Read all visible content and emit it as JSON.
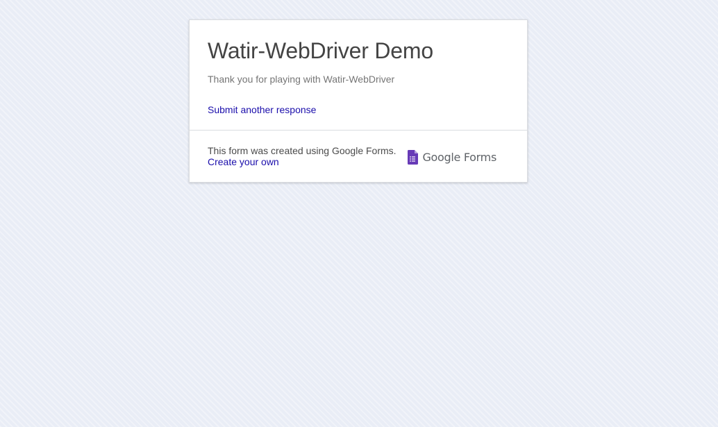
{
  "form": {
    "title": "Watir-WebDriver Demo",
    "confirmation": "Thank you for playing with Watir-WebDriver",
    "submit_another_label": "Submit another response"
  },
  "footer": {
    "created_text": "This form was created using Google Forms.",
    "create_own_label": "Create your own",
    "logo_text": "Google Forms",
    "logo_icon": "google-forms-icon"
  },
  "colors": {
    "background": "#e9edf6",
    "card": "#ffffff",
    "link": "#1a0dab",
    "forms_purple": "#673ab7"
  }
}
